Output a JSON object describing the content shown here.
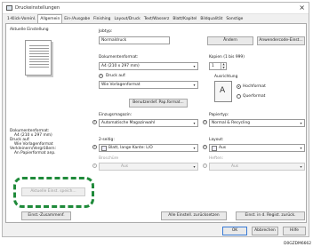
{
  "window": {
    "title": "Druckeinstellungen"
  },
  "tabs": [
    {
      "label": "1-Klick-Voreinl.",
      "active": false
    },
    {
      "label": "Allgemein",
      "active": true
    },
    {
      "label": "Ein-/Ausgabe",
      "active": false
    },
    {
      "label": "Finishing",
      "active": false
    },
    {
      "label": "Layout/Druck",
      "active": false
    },
    {
      "label": "Text/Wasserz",
      "active": false
    },
    {
      "label": "Blatt/Kapitel",
      "active": false
    },
    {
      "label": "Bildqualität",
      "active": false
    },
    {
      "label": "Sonstige",
      "active": false
    }
  ],
  "left": {
    "heading": "Aktuelle Einstellung",
    "summary_lines": [
      "Dokumentenformat:",
      "  A4 (210 x 297 mm)",
      "Druck auf:",
      "  Wie Vorlagenformat",
      "Verkleinern/Vergrößern:",
      "  An Papierformat anp."
    ],
    "current_setting_button": "Aktuelle Einst. speich...",
    "einst_zusammenf_button": "Einst.-Zusammenf."
  },
  "job": {
    "label": "Jobtyp:",
    "value": "Normaldruck",
    "change_button": "Ändern",
    "user_code_button": "Anwendercode-Einst..."
  },
  "document_size": {
    "label": "Dokumentenformat:",
    "value": "A4 (210 x 297 mm)"
  },
  "print_on": {
    "label": "Druck auf:",
    "value": "Wie Vorlagenformat"
  },
  "custom_size_button": "Benutzerdef. Pap.format...",
  "input_tray": {
    "label": "Einzugsmagazin:",
    "value": "Automatische Magazinwahl"
  },
  "copies": {
    "label": "Kopien (1 bis 999)",
    "value": "1"
  },
  "orientation": {
    "label": "Ausrichtung",
    "options": [
      "Hochformat",
      "Querformat"
    ],
    "selected": "Hochformat"
  },
  "paper_type": {
    "label": "Papiertyp:",
    "value": "Normal & Recycling"
  },
  "duplex": {
    "label": "2-seitig:",
    "value": "Blatt, lange Kante: L/O"
  },
  "layout": {
    "label": "Layout:",
    "value": "Aus"
  },
  "staple": {
    "label": "Broschüre",
    "value": "Aus"
  },
  "punch": {
    "label": "Heften:",
    "value": "Aus"
  },
  "reset_all_button": "Alle Einstell. zurücksetzen",
  "reset_tab_button": "Einst. in d. Regist. zurück.",
  "footer": {
    "ok": "OK",
    "cancel": "Abbrechen",
    "help": "Hilfe"
  },
  "figure_code": "D0GZDM6662",
  "colors": {
    "highlight": "#1f8a3a",
    "accent": "#3a7bd5"
  }
}
